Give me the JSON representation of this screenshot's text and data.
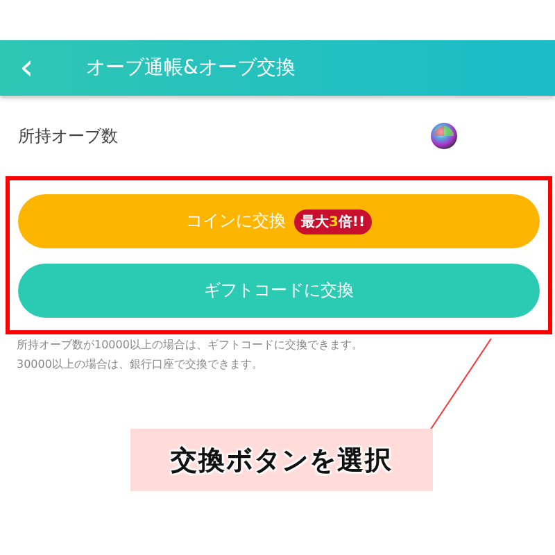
{
  "header": {
    "back": "‹",
    "title": "オーブ通帳&オーブ交換"
  },
  "balance": {
    "label": "所持オーブ数"
  },
  "buttons": [
    {
      "kind": "coin",
      "label": "コインに交換",
      "badge": "最大**3**倍!!"
    },
    {
      "kind": "gift",
      "label": "ギフトコードに交換"
    }
  ],
  "notes": [
    "所持オーブ数が10000以上の場合は、ギフトコードに交換できます。",
    "30000以上の場合は、銀行口座で交換できます。"
  ],
  "callout": "交換ボタンを選択"
}
